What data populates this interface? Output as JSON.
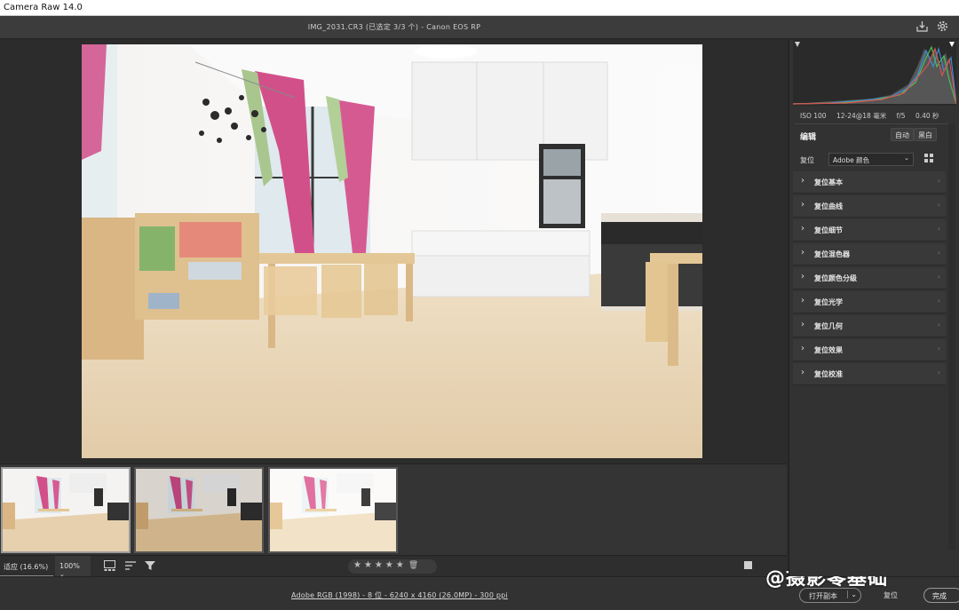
{
  "app": {
    "title": "Camera Raw 14.0"
  },
  "topbar": {
    "file_info": "IMG_2031.CR3  (已选定 3/3 个)  -  Canon EOS RP",
    "save_icon": "download-icon",
    "settings_icon": "gear-icon"
  },
  "filmstrip": {
    "thumbs": [
      {
        "variant": "dark"
      },
      {
        "variant": "warm"
      },
      {
        "variant": "bright"
      }
    ]
  },
  "bottombar": {
    "zoom_fit": "适应 (16.6%)",
    "zoom_pct": "100% ",
    "stars": "★★★★★"
  },
  "status": {
    "link": "Adobe RGB (1998) - 8 位 - 6240 x 4160 (26.0MP) - 300 ppi",
    "open_button": "打开副本",
    "reset_button": "复位",
    "done_button": "完成"
  },
  "watermark": "@摄影零基础",
  "panel": {
    "exif": {
      "iso": "ISO 100",
      "focal": "12-24@18 毫米",
      "aperture": "f/5",
      "shutter": "0.40 秒"
    },
    "edit_title": "编辑",
    "auto": "自动",
    "bw": "黑白",
    "profile_label": "复位",
    "profile_value": "Adobe 颜色",
    "sections": [
      "复位基本",
      "复位曲线",
      "复位细节",
      "复位混色器",
      "复位颜色分级",
      "复位光学",
      "复位几何",
      "复位效果",
      "复位校准"
    ]
  },
  "colors": {
    "accent": "#8a8a8a",
    "curtain": "#d2508a",
    "floor": "#e8d4b4"
  }
}
